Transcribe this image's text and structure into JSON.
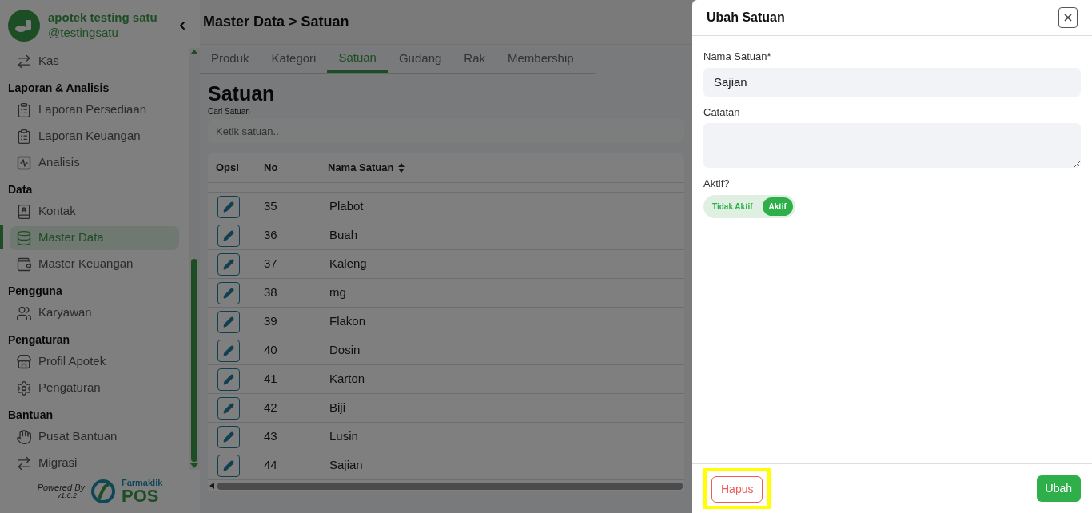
{
  "sidebar": {
    "brand": {
      "name": "apotek testing satu",
      "handle": "@testingsatu"
    },
    "sections": [
      {
        "items": [
          {
            "label": "Kas",
            "selected": false
          }
        ]
      },
      {
        "title": "Laporan & Analisis",
        "items": [
          {
            "label": "Laporan Persediaan",
            "selected": false
          },
          {
            "label": "Laporan Keuangan",
            "selected": false
          },
          {
            "label": "Analisis",
            "selected": false
          }
        ]
      },
      {
        "title": "Data",
        "items": [
          {
            "label": "Kontak",
            "selected": false
          },
          {
            "label": "Master Data",
            "selected": true
          },
          {
            "label": "Master Keuangan",
            "selected": false
          }
        ]
      },
      {
        "title": "Pengguna",
        "items": [
          {
            "label": "Karyawan",
            "selected": false
          }
        ]
      },
      {
        "title": "Pengaturan",
        "items": [
          {
            "label": "Profil Apotek",
            "selected": false
          },
          {
            "label": "Pengaturan",
            "selected": false
          }
        ]
      },
      {
        "title": "Bantuan",
        "items": [
          {
            "label": "Pusat Bantuan",
            "selected": false
          },
          {
            "label": "Migrasi",
            "selected": false
          }
        ]
      }
    ],
    "footer": {
      "powered_by": "Powered By",
      "version": "v1.6.2",
      "logo_top": "Farmaklik",
      "logo_bottom": "POS"
    }
  },
  "header": {
    "title": "Master Data > Satuan"
  },
  "tabs": [
    {
      "label": "Produk",
      "selected": false
    },
    {
      "label": "Kategori",
      "selected": false
    },
    {
      "label": "Satuan",
      "selected": true
    },
    {
      "label": "Gudang",
      "selected": false
    },
    {
      "label": "Rak",
      "selected": false
    },
    {
      "label": "Membership",
      "selected": false
    }
  ],
  "page": {
    "heading": "Satuan",
    "search_label": "Cari Satuan",
    "search_placeholder": "Ketik satuan..",
    "table": {
      "columns": [
        "Opsi",
        "No",
        "Nama Satuan"
      ],
      "rows": [
        {
          "no": "35",
          "name": "Plabot"
        },
        {
          "no": "36",
          "name": "Buah"
        },
        {
          "no": "37",
          "name": "Kaleng"
        },
        {
          "no": "38",
          "name": "mg"
        },
        {
          "no": "39",
          "name": "Flakon"
        },
        {
          "no": "40",
          "name": "Dosin"
        },
        {
          "no": "41",
          "name": "Karton"
        },
        {
          "no": "42",
          "name": "Biji"
        },
        {
          "no": "43",
          "name": "Lusin"
        },
        {
          "no": "44",
          "name": "Sajian"
        }
      ]
    }
  },
  "drawer": {
    "title": "Ubah Satuan",
    "name_label": "Nama Satuan*",
    "name_value": "Sajian",
    "note_label": "Catatan",
    "active_label": "Aktif?",
    "toggle": {
      "off_label": "Tidak Aktif",
      "on_label": "Aktif",
      "on": true
    },
    "delete_button": "Hapus",
    "submit_button": "Ubah",
    "highlight_delete": true
  }
}
